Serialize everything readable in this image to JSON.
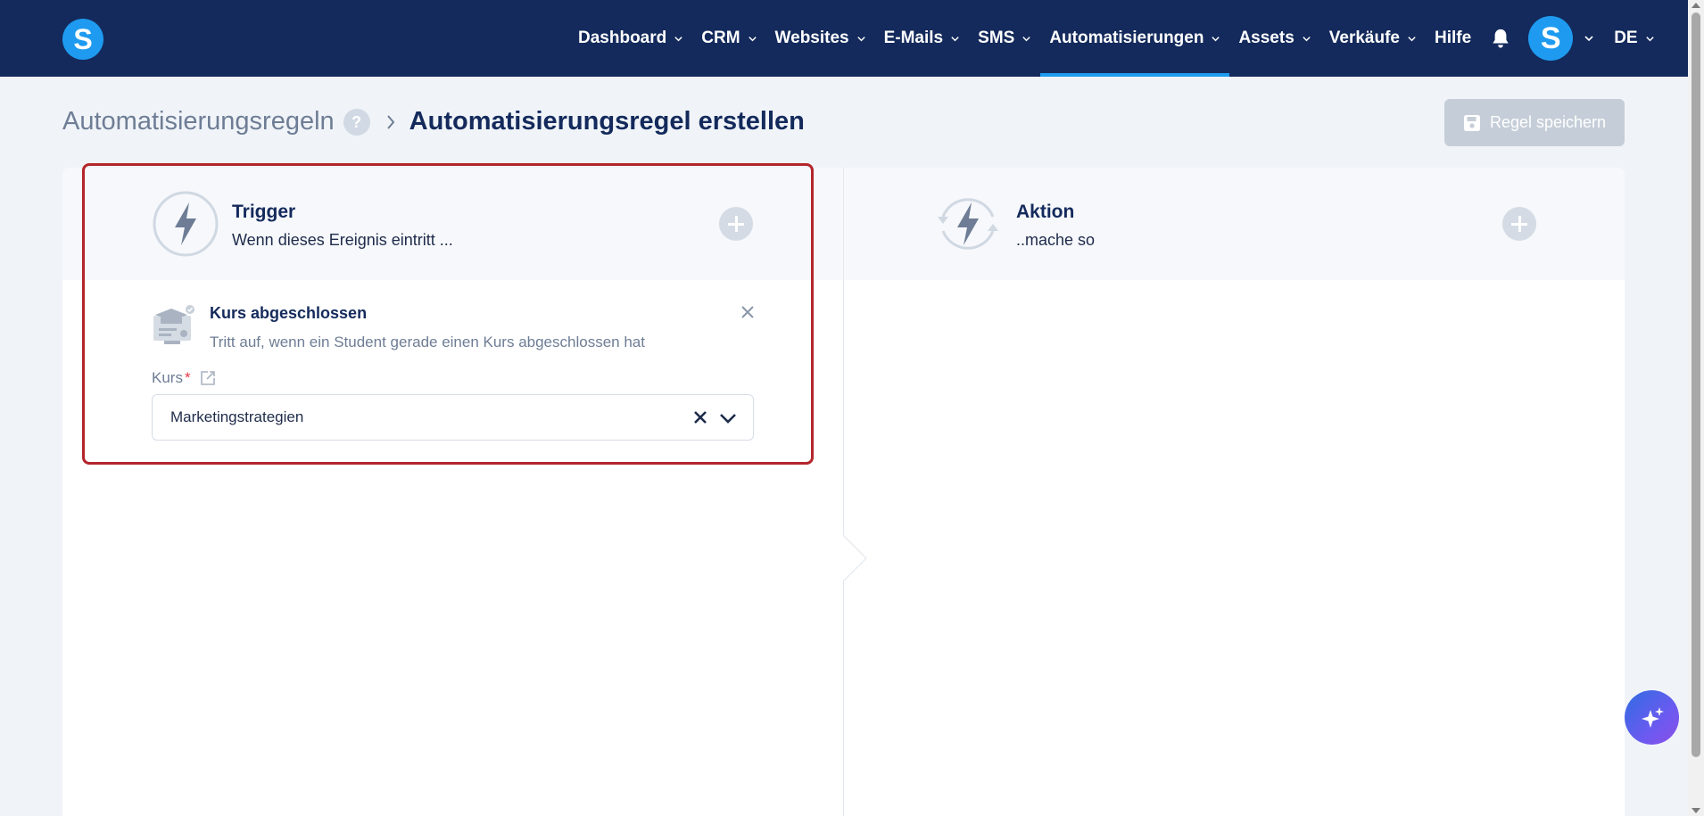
{
  "topbar": {
    "logo_letter": "S",
    "nav": [
      {
        "label": "Dashboard",
        "has_menu": true
      },
      {
        "label": "CRM",
        "has_menu": true
      },
      {
        "label": "Websites",
        "has_menu": true
      },
      {
        "label": "E-Mails",
        "has_menu": true
      },
      {
        "label": "SMS",
        "has_menu": true
      },
      {
        "label": "Automatisierungen",
        "has_menu": true,
        "active": true
      },
      {
        "label": "Assets",
        "has_menu": true
      },
      {
        "label": "Verkäufe",
        "has_menu": true
      },
      {
        "label": "Hilfe",
        "has_menu": false
      }
    ],
    "avatar_letter": "S",
    "language": "DE"
  },
  "header": {
    "breadcrumb_root": "Automatisierungsregeln",
    "help_symbol": "?",
    "breadcrumb_current": "Automatisierungsregel erstellen",
    "save_label": "Regel speichern"
  },
  "trigger": {
    "title": "Trigger",
    "subtitle": "Wenn dieses Ereignis eintritt ...",
    "item": {
      "title": "Kurs abgeschlossen",
      "description": "Tritt auf, wenn ein Student gerade einen Kurs abgeschlossen hat",
      "field_label": "Kurs",
      "required_mark": "*",
      "selected_value": "Marketingstrategien"
    }
  },
  "action": {
    "title": "Aktion",
    "subtitle": "..mache so"
  },
  "colors": {
    "topbar_bg": "#142a5c",
    "accent": "#1e9bf0",
    "highlight_border": "#b3262b",
    "save_disabled": "#c5ced8"
  },
  "icons": {
    "logo": "brand-s-logo",
    "bell": "bell-icon",
    "trigger": "lightning-bolt-icon",
    "action": "lightning-bolt-cycle-icon",
    "course": "graduation-certificate-icon",
    "ai": "sparkles-icon"
  }
}
